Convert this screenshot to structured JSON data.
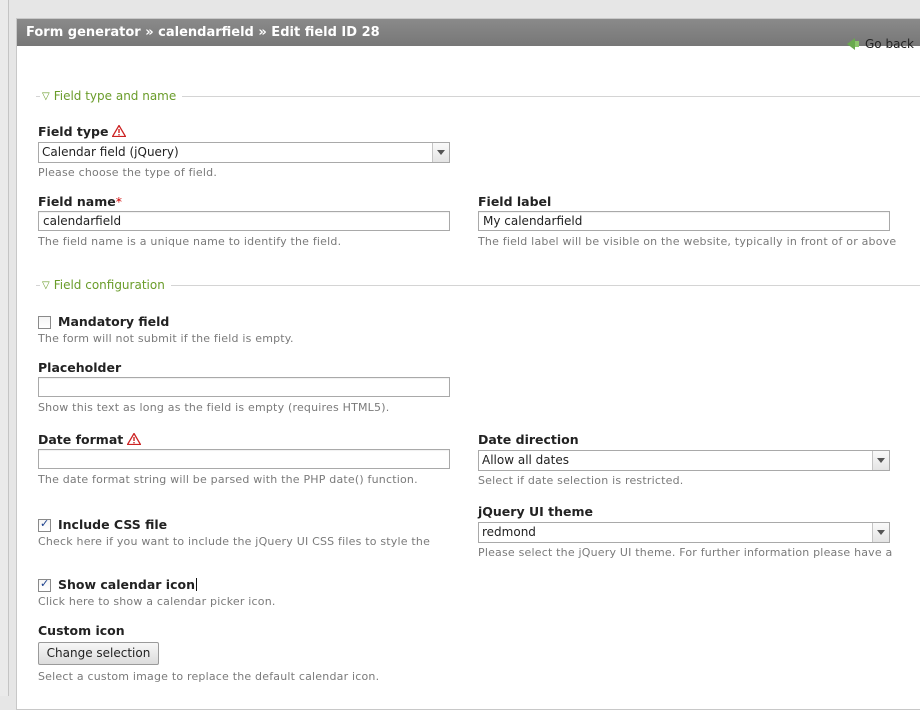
{
  "header": {
    "breadcrumb": "Form generator » calendarfield » Edit field ID 28"
  },
  "go_back": "Go back",
  "sections": {
    "type_name": "Field type and name",
    "configuration": "Field configuration"
  },
  "fields": {
    "field_type": {
      "label": "Field type",
      "value": "Calendar field (jQuery)",
      "help": "Please choose the type of field."
    },
    "field_name": {
      "label": "Field name",
      "required_mark": "*",
      "value": "calendarfield",
      "help": "The field name is a unique name to identify the field."
    },
    "field_label": {
      "label": "Field label",
      "value": "My calendarfield",
      "help": "The field label will be visible on the website, typically in front of or above"
    },
    "mandatory": {
      "label": "Mandatory field",
      "checked": false,
      "help": "The form will not submit if the field is empty."
    },
    "placeholder": {
      "label": "Placeholder",
      "value": "",
      "help": "Show this text as long as the field is empty (requires HTML5)."
    },
    "date_format": {
      "label": "Date format",
      "value": "",
      "help": "The date format string will be parsed with the PHP date() function."
    },
    "date_direction": {
      "label": "Date direction",
      "value": "Allow all dates",
      "help": "Select if date selection is restricted."
    },
    "include_css": {
      "label": "Include CSS file",
      "checked": true,
      "help": "Check here if you want to include the jQuery UI CSS files to style the"
    },
    "ui_theme": {
      "label": "jQuery UI theme",
      "value": "redmond",
      "help": "Please select the jQuery UI theme. For further information please have a"
    },
    "show_icon": {
      "label": "Show calendar icon",
      "checked": true,
      "help": "Click here to show a calendar picker icon."
    },
    "custom_icon": {
      "label": "Custom icon",
      "button": "Change selection",
      "help": "Select a custom image to replace the default calendar icon."
    }
  },
  "colors": {
    "header_bg": "#7d7d7d",
    "legend": "#6a9c2a",
    "required": "#cc0000",
    "warning": "#cc2222"
  }
}
